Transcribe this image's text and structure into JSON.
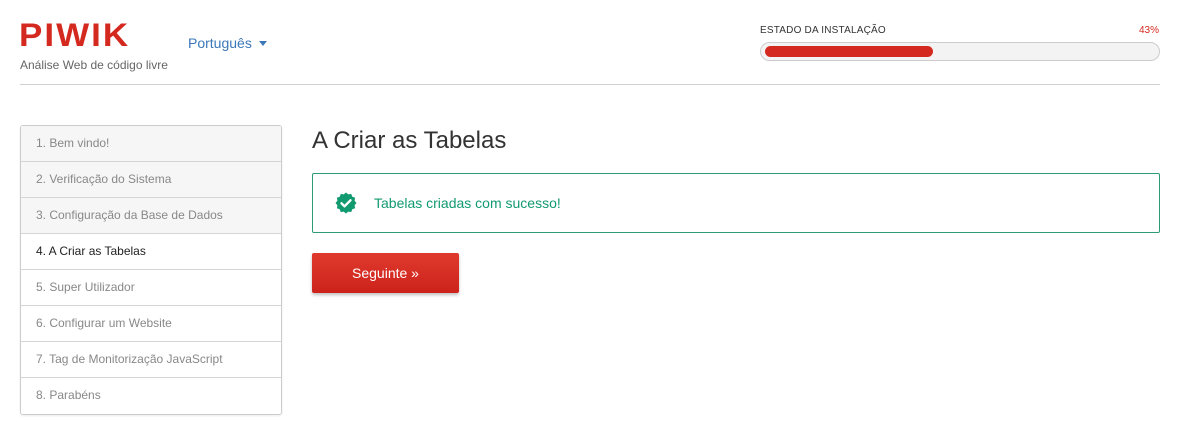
{
  "brand": {
    "logo_text": "PIWIK",
    "tagline": "Análise Web de código livre",
    "accent_color": "#d4291f"
  },
  "language": {
    "selected": "Português",
    "icon": "caret-down-icon"
  },
  "install_progress": {
    "label": "ESTADO DA INSTALAÇÃO",
    "percent_text": "43%",
    "percent": 43
  },
  "steps": [
    {
      "label": "1. Bem vindo!",
      "state": "done"
    },
    {
      "label": "2. Verificação do Sistema",
      "state": "done"
    },
    {
      "label": "3. Configuração da Base de Dados",
      "state": "done"
    },
    {
      "label": "4. A Criar as Tabelas",
      "state": "current"
    },
    {
      "label": "5. Super Utilizador",
      "state": "pending"
    },
    {
      "label": "6. Configurar um Website",
      "state": "pending"
    },
    {
      "label": "7. Tag de Monitorização JavaScript",
      "state": "pending"
    },
    {
      "label": "8. Parabéns",
      "state": "pending"
    }
  ],
  "main": {
    "title": "A Criar as Tabelas",
    "success_message": "Tabelas criadas com sucesso!",
    "success_icon": "check-badge-icon",
    "success_color": "#119a70",
    "next_button_label": "Seguinte »"
  }
}
